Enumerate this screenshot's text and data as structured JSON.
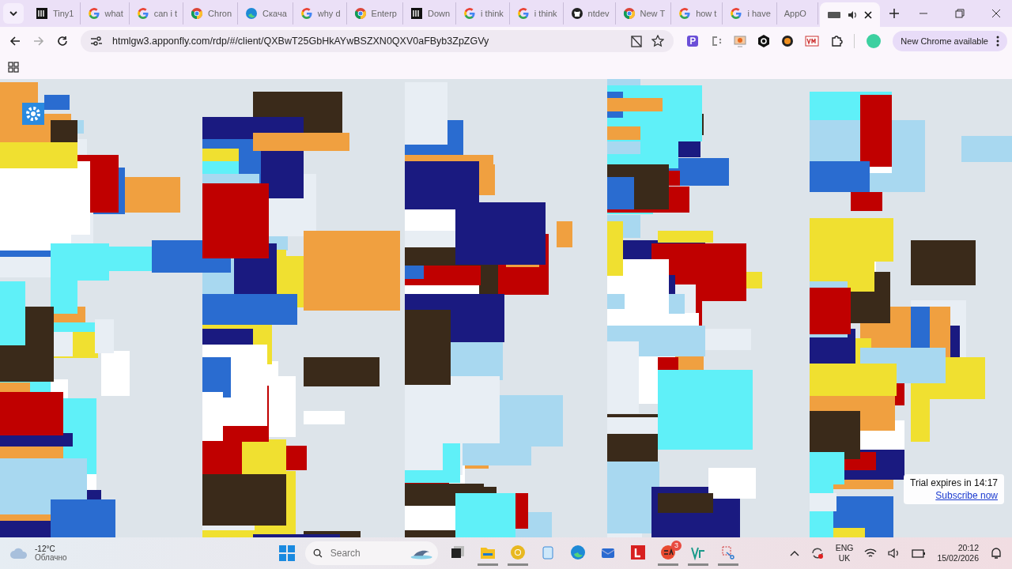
{
  "tabs": [
    {
      "title": "Tiny1",
      "kind": "site",
      "selected": false
    },
    {
      "title": "what",
      "kind": "google",
      "selected": false
    },
    {
      "title": "can i t",
      "kind": "google",
      "selected": false
    },
    {
      "title": "Chron",
      "kind": "chrome",
      "selected": false
    },
    {
      "title": "Скача",
      "kind": "edge",
      "selected": false
    },
    {
      "title": "why d",
      "kind": "google",
      "selected": false
    },
    {
      "title": "Enterp",
      "kind": "chrome",
      "selected": false
    },
    {
      "title": "Down",
      "kind": "site",
      "selected": false
    },
    {
      "title": "i think",
      "kind": "google",
      "selected": false
    },
    {
      "title": "i think",
      "kind": "google",
      "selected": false
    },
    {
      "title": "ntdev",
      "kind": "github",
      "selected": false
    },
    {
      "title": "New T",
      "kind": "chrome",
      "selected": false
    },
    {
      "title": "how t",
      "kind": "google",
      "selected": false
    },
    {
      "title": "i have",
      "kind": "google",
      "selected": false
    },
    {
      "title": "AppO",
      "kind": "none",
      "selected": false
    },
    {
      "kind": "media",
      "selected": true
    }
  ],
  "address_bar": {
    "url": "htmlgw3.apponfly.com/rdp/#/client/QXBwT25GbHkAYwBSZXN0QXV0aFByb3ZpZGVy"
  },
  "update_button": "New Chrome available",
  "remote_desktop": {
    "trial_notice": "Trial expires in 14:17",
    "subscribe_link": "Subscribe now"
  },
  "taskbar": {
    "weather_temp": "-12°C",
    "weather_text": "Облачно",
    "search_placeholder": "Search",
    "apps": [
      {
        "kind": "explorer",
        "running": false
      },
      {
        "kind": "files",
        "running": true
      },
      {
        "kind": "chrome",
        "running": true
      },
      {
        "kind": "tablet",
        "running": false
      },
      {
        "kind": "edge",
        "running": false
      },
      {
        "kind": "mail",
        "running": false
      },
      {
        "kind": "letter",
        "running": false
      },
      {
        "kind": "ea",
        "running": true,
        "badge": "3"
      },
      {
        "kind": "code",
        "running": true
      },
      {
        "kind": "snip",
        "running": true
      }
    ],
    "language": "ENG",
    "region": "UK",
    "time": "20:12",
    "date": "15/02/2026"
  }
}
